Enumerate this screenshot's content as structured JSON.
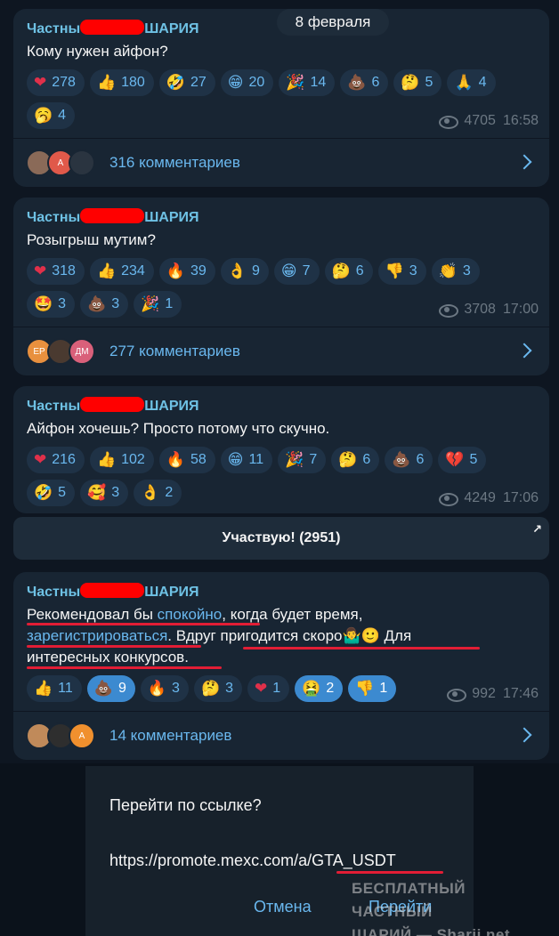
{
  "date_pill": "8 февраля",
  "sender_prefix": "Частны",
  "sender_suffix": "ШАРИЯ",
  "posts": [
    {
      "text": "Кому нужен айфон?",
      "reactions": [
        {
          "emoji": "❤",
          "count": "278"
        },
        {
          "emoji": "👍",
          "count": "180"
        },
        {
          "emoji": "🤣",
          "count": "27"
        },
        {
          "emoji": "😁",
          "count": "20"
        },
        {
          "emoji": "🎉",
          "count": "14"
        },
        {
          "emoji": "💩",
          "count": "6"
        },
        {
          "emoji": "🤔",
          "count": "5"
        },
        {
          "emoji": "🙏",
          "count": "4"
        },
        {
          "emoji": "🥱",
          "count": "4"
        }
      ],
      "views": "4705",
      "time": "16:58",
      "comments": "316 комментариев"
    },
    {
      "text": "Розыгрыш мутим?",
      "reactions": [
        {
          "emoji": "❤",
          "count": "318"
        },
        {
          "emoji": "👍",
          "count": "234"
        },
        {
          "emoji": "🔥",
          "count": "39"
        },
        {
          "emoji": "👌",
          "count": "9"
        },
        {
          "emoji": "😁",
          "count": "7"
        },
        {
          "emoji": "🤔",
          "count": "6"
        },
        {
          "emoji": "👎",
          "count": "3"
        },
        {
          "emoji": "👏",
          "count": "3"
        },
        {
          "emoji": "🤩",
          "count": "3"
        },
        {
          "emoji": "💩",
          "count": "3"
        },
        {
          "emoji": "🎉",
          "count": "1"
        }
      ],
      "views": "3708",
      "time": "17:00",
      "comments": "277 комментариев"
    },
    {
      "text": "Айфон хочешь? Просто потому что скучно.",
      "reactions": [
        {
          "emoji": "❤",
          "count": "216"
        },
        {
          "emoji": "👍",
          "count": "102"
        },
        {
          "emoji": "🔥",
          "count": "58"
        },
        {
          "emoji": "😁",
          "count": "11"
        },
        {
          "emoji": "🎉",
          "count": "7"
        },
        {
          "emoji": "🤔",
          "count": "6"
        },
        {
          "emoji": "💩",
          "count": "6"
        },
        {
          "emoji": "💔",
          "count": "5"
        },
        {
          "emoji": "🤣",
          "count": "5"
        },
        {
          "emoji": "🥰",
          "count": "3"
        },
        {
          "emoji": "👌",
          "count": "2"
        }
      ],
      "views": "4249",
      "time": "17:06",
      "button": "Участвую! (2951)"
    },
    {
      "text_part1": "Рекомендовал бы ",
      "link1": "спокойно",
      "text_part2": ", когда будет время, ",
      "link2": "зарегистрироваться",
      "text_part3": ". Вдруг пригодится скоро🤷‍♂️🙂 Для интересных конкурсов.",
      "reactions": [
        {
          "emoji": "👍",
          "count": "11",
          "active": false
        },
        {
          "emoji": "💩",
          "count": "9",
          "active": true
        },
        {
          "emoji": "🔥",
          "count": "3",
          "active": false
        },
        {
          "emoji": "🤔",
          "count": "3",
          "active": false
        },
        {
          "emoji": "❤",
          "count": "1",
          "active": false
        },
        {
          "emoji": "🤮",
          "count": "2",
          "active": true
        },
        {
          "emoji": "👎",
          "count": "1",
          "active": true
        }
      ],
      "views": "992",
      "time": "17:46",
      "comments": "14 комментариев"
    }
  ],
  "dialog": {
    "question": "Перейти по ссылке?",
    "url": "https://promote.mexc.com/a/GTA_USDT",
    "cancel": "Отмена",
    "go": "Перейти"
  },
  "watermark": {
    "line1": "БЕСПЛАТНЫЙ ЧАСТНЫЙ",
    "line2": "ШАРИЙ — Sharij.net"
  },
  "colors": {
    "background": "#0e1621",
    "bubble": "#182533",
    "accent": "#6ab8ef",
    "sender": "#6ec1e4",
    "highlight_underline": "#e21d35"
  }
}
